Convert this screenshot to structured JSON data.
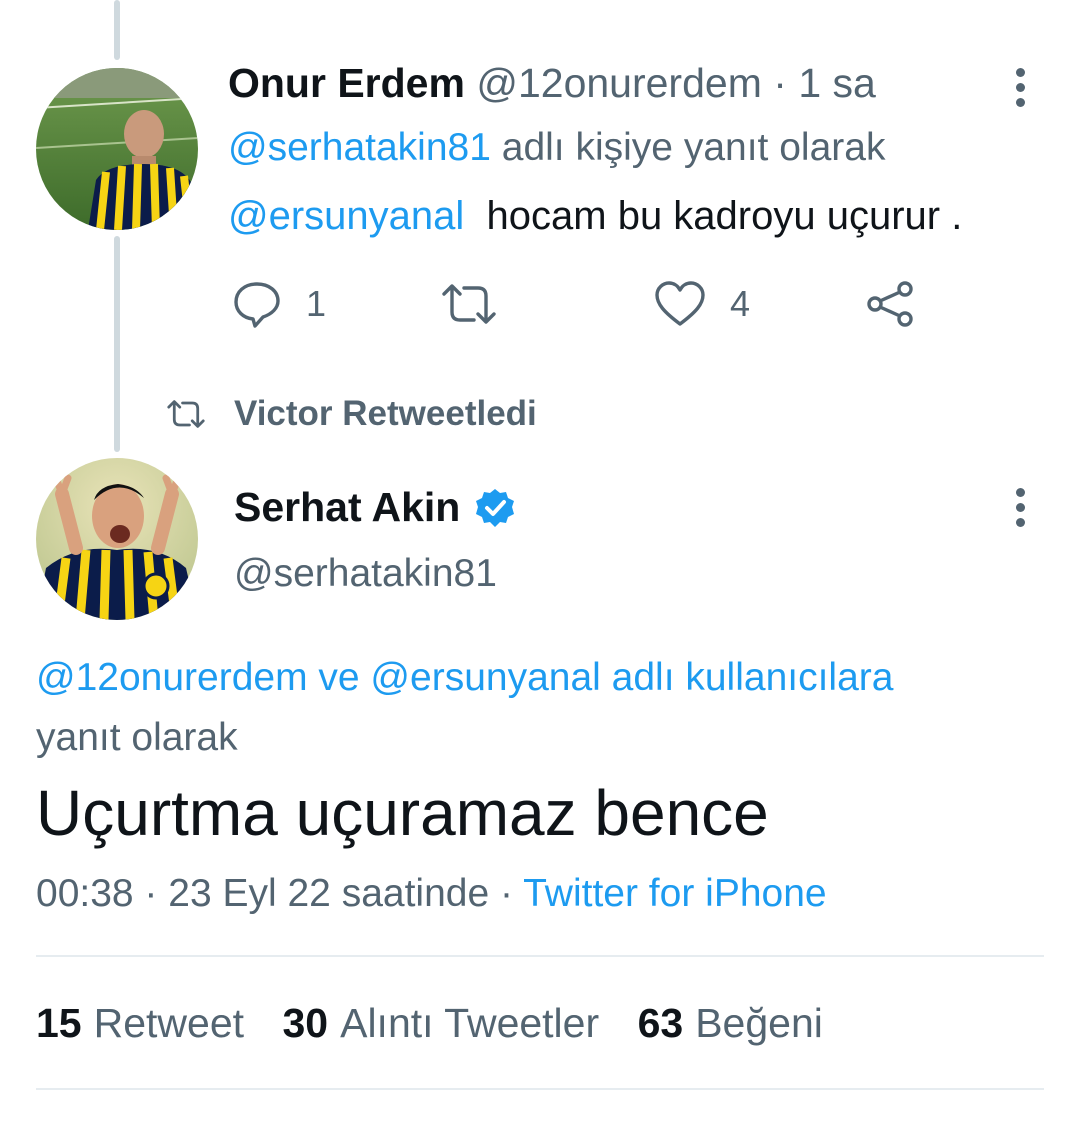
{
  "reply_tweet": {
    "display_name": "Onur Erdem",
    "handle": "@12onurerdem",
    "time_sep": "·",
    "time": "1 sa",
    "reply_to_handle": "@serhatakin81",
    "reply_to_suffix": "adlı kişiye yanıt olarak",
    "mention": "@ersunyanal",
    "text": "hocam bu kadroyu uçurur .",
    "actions": {
      "reply_count": "1",
      "retweet_count": "",
      "like_count": "4"
    }
  },
  "retweet_banner": {
    "label": "Victor Retweetledi"
  },
  "main_tweet": {
    "display_name": "Serhat Akin",
    "handle": "@serhatakin81",
    "reply_context_handles": "@12onurerdem ve @ersunyanal adlı kullanıcılara",
    "reply_context_suffix": "yanıt olarak",
    "text": "Uçurtma uçuramaz bence",
    "meta_time": "00:38 · 23 Eyl 22 saatinde ·",
    "meta_source": "Twitter for iPhone"
  },
  "stats": [
    {
      "count": "15",
      "label": "Retweet"
    },
    {
      "count": "30",
      "label": "Alıntı Tweetler"
    },
    {
      "count": "63",
      "label": "Beğeni"
    }
  ],
  "colors": {
    "accent": "#1d9bf0",
    "muted_text": "#536471",
    "primary_text": "#0f1419"
  }
}
